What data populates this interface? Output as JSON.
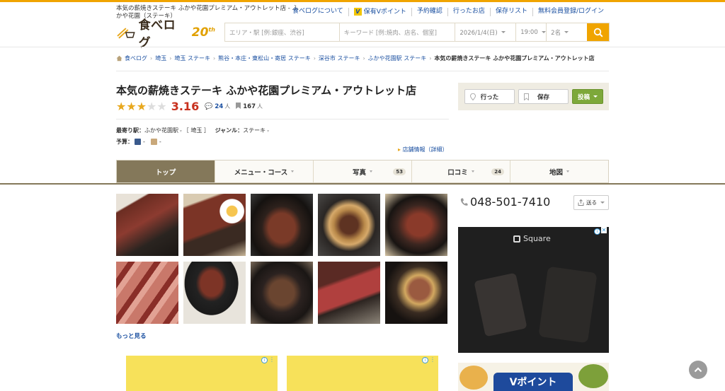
{
  "header": {
    "description": "本気の薪焼きステーキ ふかや花園プレミアム・アウトレット店 - ふかや花園（ステーキ）",
    "nav": [
      "食べログについて",
      "保有Vポイント",
      "予約確認",
      "行ったお店",
      "保存リスト",
      "無料会員登録/ログイン"
    ],
    "logo_text": "食べログ",
    "logo_anniv": "20",
    "logo_anniv_sup": "th"
  },
  "search": {
    "area_placeholder": "エリア・駅 [例:銀座、渋谷]",
    "keyword_placeholder": "キーワード [例:焼肉、店名、個室]",
    "date": "2026/1/4(日)",
    "time": "19:00",
    "people": "2名"
  },
  "breadcrumb": [
    "食べログ",
    "埼玉",
    "埼玉 ステーキ",
    "熊谷・本庄・東松山・寄居 ステーキ",
    "深谷市 ステーキ",
    "ふかや花園駅 ステーキ",
    "本気の薪焼きステーキ ふかや花園プレミアム・アウトレット店"
  ],
  "restaurant": {
    "name": "本気の薪焼きステーキ ふかや花園プレミアム・アウトレット店",
    "score": "3.16",
    "stars": 3,
    "reviews": "24",
    "reviews_unit": "人",
    "saves": "167",
    "saves_unit": "人",
    "station_label": "最寄り駅：",
    "station": "ふかや花園駅",
    "pref": "［ 埼玉 ］",
    "genre_label": "ジャンル：",
    "genre": "ステーキ",
    "budget_label": "予算：",
    "budget_dinner": "-",
    "budget_lunch": "-",
    "detail_link": "店舗情報（詳細）"
  },
  "actions": {
    "went": "行った",
    "save": "保存",
    "post": "投稿"
  },
  "tabs": [
    {
      "label": "トップ",
      "count": ""
    },
    {
      "label": "メニュー・コース",
      "count": ""
    },
    {
      "label": "写真",
      "count": "53"
    },
    {
      "label": "口コミ",
      "count": "24"
    },
    {
      "label": "地図",
      "count": ""
    }
  ],
  "more_link": "もっと見る",
  "phone": "048-501-7410",
  "send_label": "送る",
  "ads": {
    "square_brand": "Square",
    "vpoint_text": "Vポイント"
  },
  "colors": {
    "accent": "#f0a400",
    "tab_active": "#84785a",
    "score": "#c8311e",
    "link": "#1a4fa0",
    "post_button": "#7da83a"
  }
}
